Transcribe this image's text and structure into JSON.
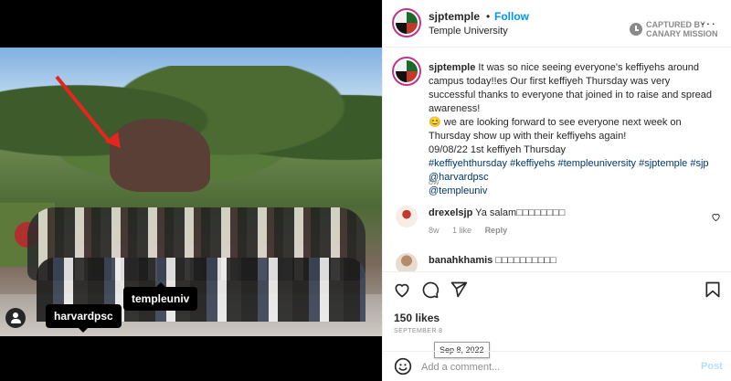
{
  "media": {
    "tags": [
      "harvardpsc",
      "templeuniv"
    ]
  },
  "header": {
    "username": "sjptemple",
    "separator": "•",
    "follow_label": "Follow",
    "location": "Temple University",
    "watermark_line1": "CAPTURED BY",
    "watermark_line2": "CANARY MISSION",
    "more": "···"
  },
  "caption": {
    "username": "sjptemple",
    "line1": "It was so nice seeing everyone's keffiyehs around campus today!!es Our first keffiyeh Thursday was very successful thanks to everyone that joined in to raise and spread awareness!",
    "emoji": "😊",
    "line2": "we are looking forward to see everyone next week on Thursday show up with their keffiyehs again!",
    "line3": "09/08/22 1st keffiyeh Thursday",
    "hashtags": "#keffiyehthursday #keffiyehs #templeuniversity #sjptemple #sjp",
    "mention1": "@harvardpsc",
    "mention2": "@templeuniv",
    "time": "8w"
  },
  "comments": [
    {
      "username": "drexelsjp",
      "text": "Ya salam□□□□□□□□",
      "time": "8w",
      "likes": "1 like",
      "reply": "Reply"
    },
    {
      "username": "banahkhamis",
      "text": "□□□□□□□□□□",
      "time": "",
      "likes": "",
      "reply": ""
    }
  ],
  "actions": {
    "likes": "150 likes",
    "date": "SEPTEMBER 8",
    "tooltip": "Sep 8, 2022",
    "comment_placeholder": "Add a comment...",
    "post_label": "Post"
  },
  "colors": {
    "accent": "#0095f6",
    "arrow": "#e3261f",
    "post_disabled": "#b2dffc"
  }
}
